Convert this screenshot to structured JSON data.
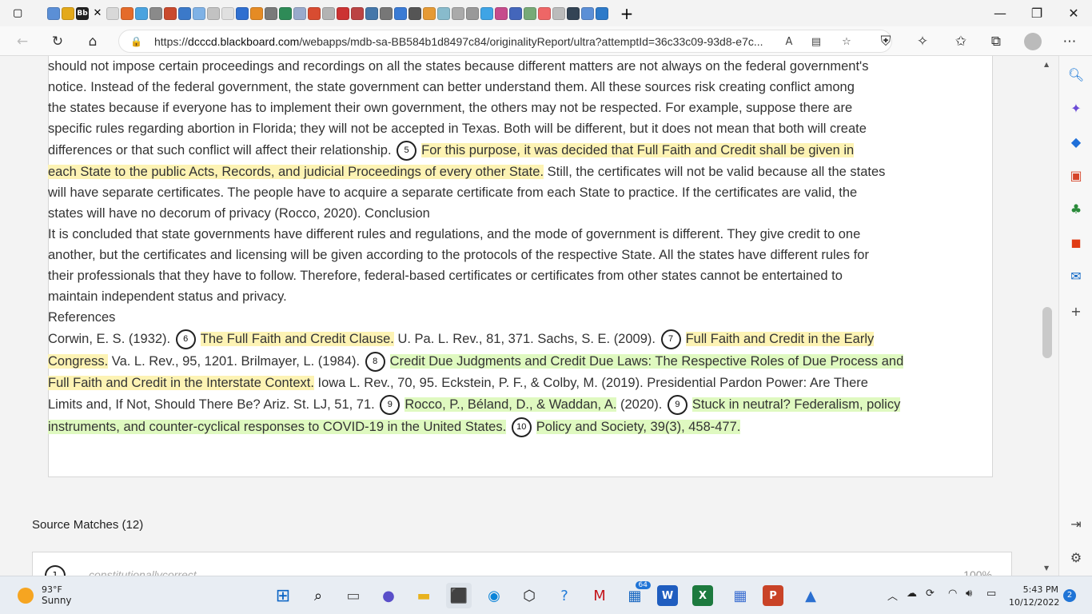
{
  "browser": {
    "active_tab_label": "Bb",
    "url_prefix": "https://",
    "url_domain": "dcccd.blackboard.com",
    "url_path": "/webapps/mdb-sa-BB584b1d8497c84/originalityReport/ultra?attemptId=36c33c09-93d8-e7c...",
    "read_aloud_label": "A"
  },
  "document": {
    "lines": [
      {
        "segments": [
          {
            "t": "should not impose certain proceedings and recordings on all the states because different matters are not always on the federal government's"
          }
        ]
      },
      {
        "segments": [
          {
            "t": "notice. Instead of the federal government, the state government can better understand them. All these sources risk creating conflict among"
          }
        ]
      },
      {
        "segments": [
          {
            "t": "the states because if everyone has to implement their own government, the others may not be respected. For example, suppose there are"
          }
        ]
      },
      {
        "segments": [
          {
            "t": "specific rules regarding abortion in Florida; they will not be accepted in Texas. Both will be different, but it does not mean that both will create"
          }
        ]
      },
      {
        "segments": [
          {
            "t": "differences or that such conflict will affect their relationship. "
          },
          {
            "m": "5"
          },
          {
            "t": "For this purpose, it was decided that Full Faith and Credit shall be given in",
            "c": "hl"
          }
        ]
      },
      {
        "segments": [
          {
            "t": "each State to the public Acts, Records, and judicial Proceedings of every other State.",
            "c": "hl"
          },
          {
            "t": " Still, the certificates will not be valid because all the states"
          }
        ]
      },
      {
        "segments": [
          {
            "t": "will have separate certificates. The people have to acquire a separate certificate from each State to practice. If the certificates are valid, the"
          }
        ]
      },
      {
        "segments": [
          {
            "t": "states will have no decorum of privacy (Rocco, 2020). Conclusion"
          }
        ]
      },
      {
        "segments": [
          {
            "t": "It is concluded that state governments have different rules and regulations, and the mode of government is different. They give credit to one"
          }
        ]
      },
      {
        "segments": [
          {
            "t": "another, but the certificates and licensing will be given according to the protocols of the respective State. All the states have different rules for"
          }
        ]
      },
      {
        "segments": [
          {
            "t": "their professionals that they have to follow. Therefore, federal-based certificates or certificates from other states cannot be entertained to"
          }
        ]
      },
      {
        "segments": [
          {
            "t": "maintain independent status and privacy."
          }
        ]
      },
      {
        "segments": [
          {
            "t": "References"
          }
        ]
      },
      {
        "segments": [
          {
            "t": "Corwin, E. S. (1932). "
          },
          {
            "m": "6"
          },
          {
            "t": "The Full Faith and Credit Clause.",
            "c": "hl"
          },
          {
            "t": " U. Pa. L. Rev., 81, 371. Sachs, S. E. (2009). "
          },
          {
            "m": "7"
          },
          {
            "t": "Full Faith and Credit in the Early",
            "c": "hl"
          }
        ]
      },
      {
        "segments": [
          {
            "t": "Congress.",
            "c": "hl"
          },
          {
            "t": " Va. L. Rev., 95, 1201. Brilmayer, L. (1984). "
          },
          {
            "m": "8"
          },
          {
            "t": "Credit Due Judgments and Credit Due Laws: The Respective Roles of Due Process and",
            "c": "hg"
          }
        ]
      },
      {
        "segments": [
          {
            "t": "Full Faith and Credit in the Interstate Context.",
            "c": "hl"
          },
          {
            "t": " Iowa L. Rev., 70, 95. Eckstein, P. F., & Colby, M. (2019). Presidential Pardon Power: Are There"
          }
        ]
      },
      {
        "segments": [
          {
            "t": "Limits and, If Not, Should There Be? Ariz. St. LJ, 51, 71. "
          },
          {
            "m": "9"
          },
          {
            "t": "Rocco, P., Béland, D., & Waddan, A.",
            "c": "hg"
          },
          {
            "t": " (2020). "
          },
          {
            "m": "9"
          },
          {
            "t": "Stuck in neutral? Federalism, policy",
            "c": "hg"
          }
        ]
      },
      {
        "segments": [
          {
            "t": "instruments, and counter-cyclical responses to COVID-19 in the United States.",
            "c": "hg"
          },
          {
            "t": " "
          },
          {
            "m": "10"
          },
          {
            "t": "Policy and Society, 39(3), 458-477.",
            "c": "hg"
          }
        ]
      }
    ]
  },
  "source_matches": {
    "heading": "Source Matches (12)",
    "first": {
      "number": "1",
      "name": "constitutionallycorrect",
      "percent": "100%"
    }
  },
  "taskbar": {
    "weather_temp": "93°F",
    "weather_desc": "Sunny",
    "teams_badge": "64",
    "time": "5:43 PM",
    "date": "10/12/2022",
    "notif_count": "2"
  }
}
